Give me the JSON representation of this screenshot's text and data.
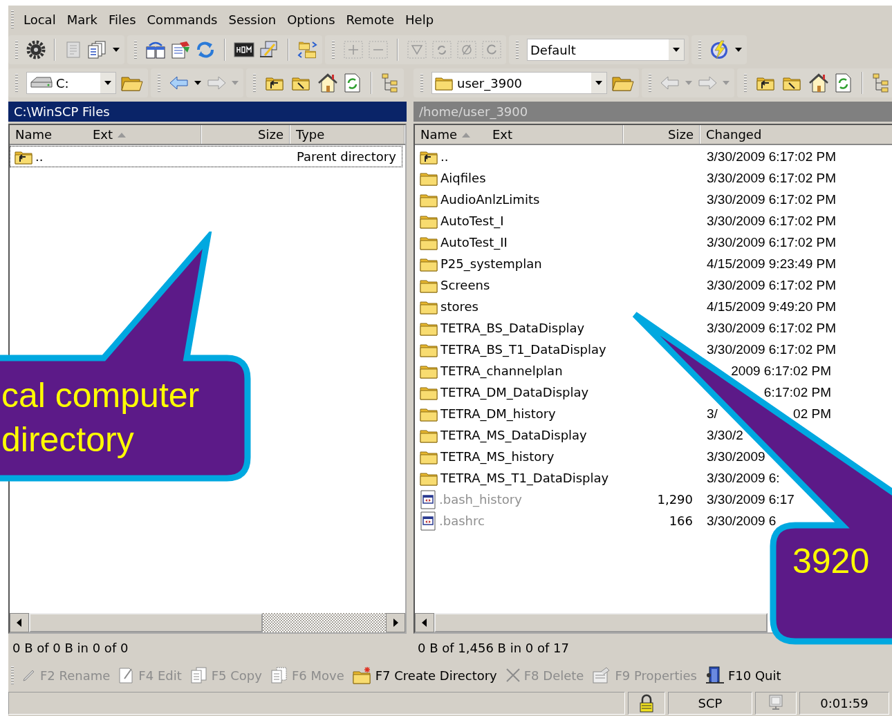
{
  "menu": [
    "Local",
    "Mark",
    "Files",
    "Commands",
    "Session",
    "Options",
    "Remote",
    "Help"
  ],
  "toolbar": {
    "profile_combo": "Default"
  },
  "panels": [
    {
      "location": "C:",
      "path": "C:\\WinSCP Files",
      "active": true,
      "columns": [
        {
          "label": "Name",
          "sorted": false
        },
        {
          "label": "Ext",
          "sorted": true
        },
        {
          "label": "Size",
          "sorted": false
        },
        {
          "label": "Type",
          "sorted": false
        }
      ],
      "rows": [
        {
          "kind": "parent",
          "name": "..",
          "type": "Parent directory",
          "focused": true,
          "dimmed": false
        }
      ],
      "status": "0 B of 0 B in 0 of 0"
    },
    {
      "location": "user_3900",
      "path": "/home/user_3900",
      "active": false,
      "columns": [
        {
          "label": "Name",
          "sorted": true
        },
        {
          "label": "Ext",
          "sorted": false
        },
        {
          "label": "Size",
          "sorted": false
        },
        {
          "label": "Changed",
          "sorted": false
        }
      ],
      "rows": [
        {
          "kind": "parent",
          "name": "..",
          "changed": "3/30/2009 6:17:02 PM",
          "focused": false,
          "dimmed": false
        },
        {
          "kind": "folder",
          "name": "Aiqfiles",
          "changed": "3/30/2009 6:17:02 PM",
          "focused": false,
          "dimmed": false
        },
        {
          "kind": "folder",
          "name": "AudioAnlzLimits",
          "changed": "3/30/2009 6:17:02 PM",
          "focused": false,
          "dimmed": false
        },
        {
          "kind": "folder",
          "name": "AutoTest_I",
          "changed": "3/30/2009 6:17:02 PM",
          "focused": false,
          "dimmed": false
        },
        {
          "kind": "folder",
          "name": "AutoTest_II",
          "changed": "3/30/2009 6:17:02 PM",
          "focused": false,
          "dimmed": false
        },
        {
          "kind": "folder",
          "name": "P25_systemplan",
          "changed": "4/15/2009 9:23:49 PM",
          "focused": false,
          "dimmed": false
        },
        {
          "kind": "folder",
          "name": "Screens",
          "changed": "3/30/2009 6:17:02 PM",
          "focused": false,
          "dimmed": false
        },
        {
          "kind": "folder",
          "name": "stores",
          "changed": "4/15/2009 9:49:20 PM",
          "focused": false,
          "dimmed": false
        },
        {
          "kind": "folder",
          "name": "TETRA_BS_DataDisplay",
          "changed": "3/30/2009 6:17:02 PM",
          "focused": false,
          "dimmed": false
        },
        {
          "kind": "folder",
          "name": "TETRA_BS_T1_DataDisplay",
          "changed": "3/30/2009 6:17:02 PM",
          "focused": false,
          "dimmed": false
        },
        {
          "kind": "folder",
          "name": "TETRA_channelplan",
          "changed_end": "2009 6:17:02 PM",
          "focused": false,
          "dimmed": false
        },
        {
          "kind": "folder",
          "name": "TETRA_DM_DataDisplay",
          "changed_end": "6:17:02 PM",
          "focused": false,
          "dimmed": false
        },
        {
          "kind": "folder",
          "name": "TETRA_DM_history",
          "changed": "3/",
          "changed_end": "02 PM",
          "focused": false,
          "dimmed": false
        },
        {
          "kind": "folder",
          "name": "TETRA_MS_DataDisplay",
          "changed": "3/30/2",
          "focused": false,
          "dimmed": false
        },
        {
          "kind": "folder",
          "name": "TETRA_MS_history",
          "changed": "3/30/2009",
          "focused": false,
          "dimmed": false
        },
        {
          "kind": "folder",
          "name": "TETRA_MS_T1_DataDisplay",
          "changed": "3/30/2009 6:",
          "focused": false,
          "dimmed": false
        },
        {
          "kind": "file",
          "name": ".bash_history",
          "size": "1,290",
          "changed": "3/30/2009 6:17",
          "focused": false,
          "dimmed": true
        },
        {
          "kind": "file",
          "name": ".bashrc",
          "size": "166",
          "changed": "3/30/2009 6",
          "focused": false,
          "dimmed": true
        }
      ],
      "status": "0 B of 1,456 B in 0 of 17"
    }
  ],
  "commands": [
    {
      "label": "F2 Rename",
      "disabled": true
    },
    {
      "label": "F4 Edit",
      "disabled": true
    },
    {
      "label": "F5 Copy",
      "disabled": true
    },
    {
      "label": "F6 Move",
      "disabled": true
    },
    {
      "label": "F7 Create Directory",
      "disabled": false
    },
    {
      "label": "F8 Delete",
      "disabled": true
    },
    {
      "label": "F9 Properties",
      "disabled": true
    },
    {
      "label": "F10 Quit",
      "disabled": false
    }
  ],
  "status_bar": {
    "protocol": "SCP",
    "duration": "0:01:59"
  },
  "callouts": [
    {
      "lines": [
        "cal computer",
        "directory"
      ]
    },
    {
      "lines": [
        "3920"
      ]
    }
  ]
}
